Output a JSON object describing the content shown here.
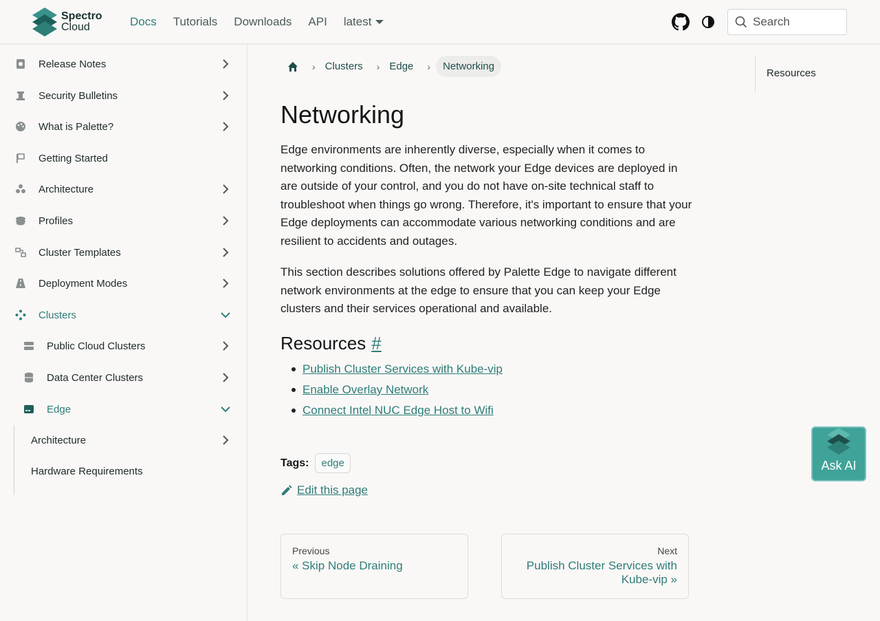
{
  "header": {
    "logo_line1": "Spectro",
    "logo_line2": "Cloud",
    "nav": [
      "Docs",
      "Tutorials",
      "Downloads",
      "API"
    ],
    "version": "latest",
    "search_placeholder": "Search"
  },
  "sidebar": {
    "items": [
      {
        "label": "Release Notes",
        "icon": "release-notes-icon"
      },
      {
        "label": "Security Bulletins",
        "icon": "security-icon"
      },
      {
        "label": "What is Palette?",
        "icon": "palette-icon"
      },
      {
        "label": "Getting Started",
        "icon": "flag-icon"
      },
      {
        "label": "Architecture",
        "icon": "architecture-icon"
      },
      {
        "label": "Profiles",
        "icon": "profiles-icon"
      },
      {
        "label": "Cluster Templates",
        "icon": "templates-icon"
      },
      {
        "label": "Deployment Modes",
        "icon": "road-icon"
      },
      {
        "label": "Clusters",
        "icon": "clusters-icon"
      },
      {
        "label": "Public Cloud Clusters",
        "icon": "server-icon"
      },
      {
        "label": "Data Center Clusters",
        "icon": "database-icon"
      },
      {
        "label": "Edge",
        "icon": "edge-icon"
      },
      {
        "label": "Architecture"
      },
      {
        "label": "Hardware Requirements"
      }
    ]
  },
  "breadcrumb": {
    "items": [
      "Clusters",
      "Edge"
    ],
    "current": "Networking"
  },
  "page": {
    "title": "Networking",
    "paragraph1": "Edge environments are inherently diverse, especially when it comes to networking conditions. Often, the network your Edge devices are deployed in are outside of your control, and you do not have on-site technical staff to troubleshoot when things go wrong. Therefore, it's important to ensure that your Edge deployments can accommodate various networking conditions and are resilient to accidents and outages.",
    "paragraph2": "This section describes solutions offered by Palette Edge to navigate different network environments at the edge to ensure that you can keep your Edge clusters and their services operational and available.",
    "resources_heading": "Resources",
    "anchor": "#",
    "resources": [
      "Publish Cluster Services with Kube-vip",
      "Enable Overlay Network",
      "Connect Intel NUC Edge Host to Wifi"
    ],
    "tags_label": "Tags:",
    "tag": "edge",
    "edit_label": "Edit this page"
  },
  "pager": {
    "prev_label": "Previous",
    "prev_title": "« Skip Node Draining",
    "next_label": "Next",
    "next_title": "Publish Cluster Services with Kube-vip »"
  },
  "toc": {
    "item": "Resources"
  },
  "ask_ai": {
    "label": "Ask AI"
  },
  "colors": {
    "accent": "#2f7d78",
    "askai_bg": "#3fa399",
    "background": "#f9f8f7"
  }
}
